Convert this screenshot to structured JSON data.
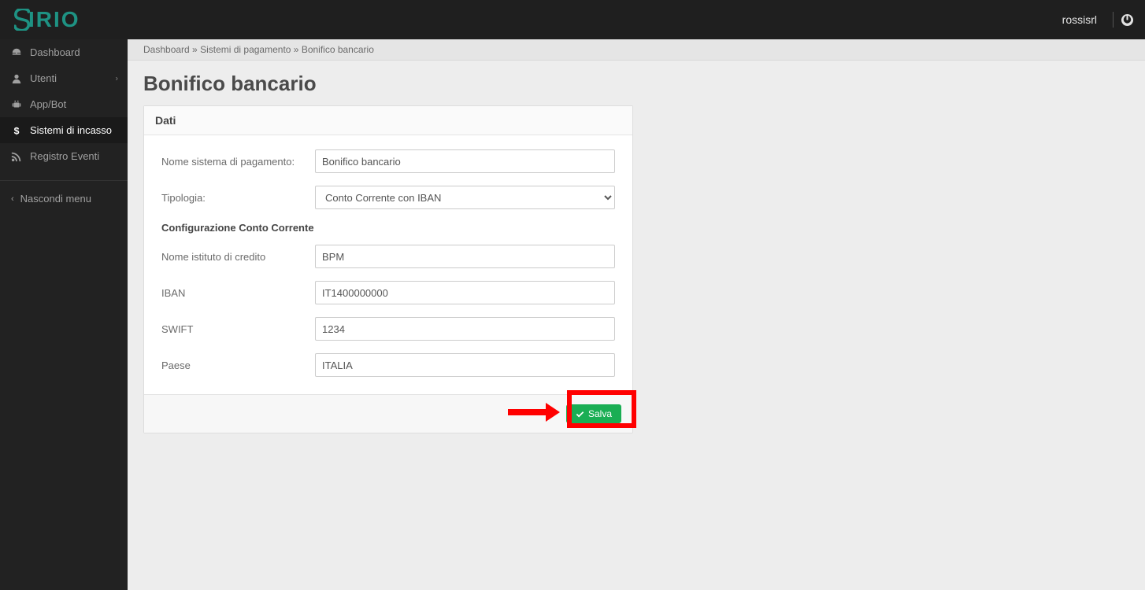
{
  "brand": "SIRIO",
  "topbar": {
    "username": "rossisrl"
  },
  "sidebar": {
    "items": [
      {
        "label": "Dashboard"
      },
      {
        "label": "Utenti"
      },
      {
        "label": "App/Bot"
      },
      {
        "label": "Sistemi di incasso"
      },
      {
        "label": "Registro Eventi"
      }
    ],
    "hide_menu": "Nascondi menu"
  },
  "breadcrumb": {
    "a": "Dashboard",
    "sep1": " » ",
    "b": "Sistemi di pagamento",
    "sep2": " » ",
    "c": "Bonifico bancario"
  },
  "page_title": "Bonifico bancario",
  "panel": {
    "title": "Dati",
    "labels": {
      "nome_sistema": "Nome sistema di pagamento:",
      "tipologia": "Tipologia:",
      "subheading": "Configurazione Conto Corrente",
      "istituto": "Nome istituto di credito",
      "iban": "IBAN",
      "swift": "SWIFT",
      "paese": "Paese"
    },
    "values": {
      "nome_sistema": "Bonifico bancario",
      "tipologia_selected": "Conto Corrente con IBAN",
      "istituto": "BPM",
      "iban": "IT1400000000",
      "swift": "1234",
      "paese": "ITALIA"
    },
    "save_label": "Salva"
  }
}
